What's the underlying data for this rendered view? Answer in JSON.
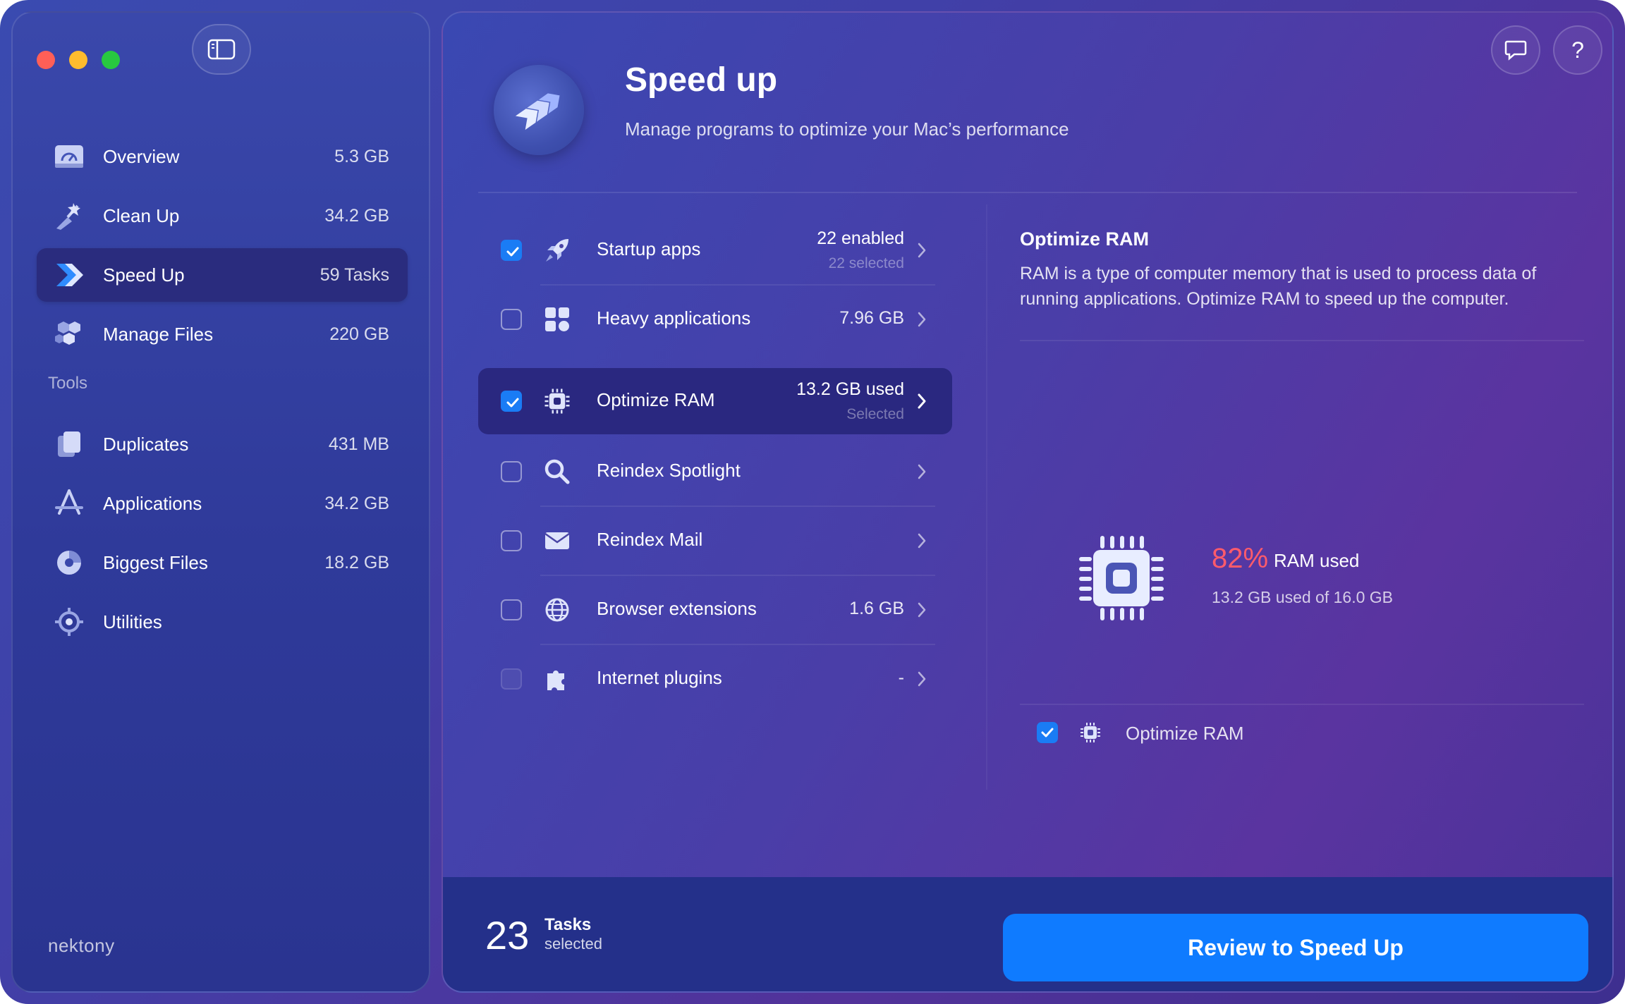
{
  "window": {
    "traffic_lights": [
      "close",
      "minimize",
      "zoom"
    ]
  },
  "sidebar": {
    "items": [
      {
        "label": "Overview",
        "value": "5.3 GB",
        "icon": "gauge-icon"
      },
      {
        "label": "Clean Up",
        "value": "34.2 GB",
        "icon": "broom-icon"
      },
      {
        "label": "Speed Up",
        "value": "59 Tasks",
        "icon": "speed-arrows-icon"
      },
      {
        "label": "Manage Files",
        "value": "220 GB",
        "icon": "files-hexagon-icon"
      }
    ],
    "tools_label": "Tools",
    "tools": [
      {
        "label": "Duplicates",
        "value": "431 MB",
        "icon": "duplicates-icon"
      },
      {
        "label": "Applications",
        "value": "34.2 GB",
        "icon": "app-store-icon"
      },
      {
        "label": "Biggest Files",
        "value": "18.2 GB",
        "icon": "pie-chart-icon"
      },
      {
        "label": "Utilities",
        "value": "",
        "icon": "utilities-icon"
      }
    ],
    "brand": "nektony"
  },
  "header": {
    "title": "Speed up",
    "subtitle": "Manage programs to optimize your Mac’s performance"
  },
  "tasks": [
    {
      "label": "Startup apps",
      "value": "22 enabled",
      "sub": "22 selected",
      "checked": true,
      "icon": "rocket-icon"
    },
    {
      "label": "Heavy applications",
      "value": "7.96 GB",
      "sub": "",
      "checked": false,
      "icon": "grid-apps-icon"
    },
    {
      "label": "Optimize RAM",
      "value": "13.2 GB used",
      "sub": "Selected",
      "checked": true,
      "icon": "chip-icon"
    },
    {
      "label": "Reindex Spotlight",
      "value": "",
      "sub": "",
      "checked": false,
      "icon": "magnifier-icon"
    },
    {
      "label": "Reindex Mail",
      "value": "",
      "sub": "",
      "checked": false,
      "icon": "mail-icon"
    },
    {
      "label": "Browser extensions",
      "value": "1.6 GB",
      "sub": "",
      "checked": false,
      "icon": "globe-icon"
    },
    {
      "label": "Internet plugins",
      "value": "-",
      "sub": "",
      "checked": false,
      "disabled": true,
      "icon": "puzzle-icon"
    }
  ],
  "detail": {
    "title": "Optimize RAM",
    "description": "RAM is a type of computer memory that is used to process data of running applications. Optimize RAM to speed up the computer.",
    "ram_percent": "82%",
    "ram_used_label": "RAM used",
    "ram_detail": "13.2 GB used of 16.0 GB",
    "option_label": "Optimize RAM",
    "option_checked": true
  },
  "footer": {
    "count": "23",
    "count_word": "Tasks",
    "count_sub": "selected",
    "button": "Review to Speed Up"
  },
  "colors": {
    "accent": "#0f7bff",
    "checkbox": "#1a7cf5",
    "ram_percent": "#ff5b6b",
    "active_row": "#2a2880"
  }
}
